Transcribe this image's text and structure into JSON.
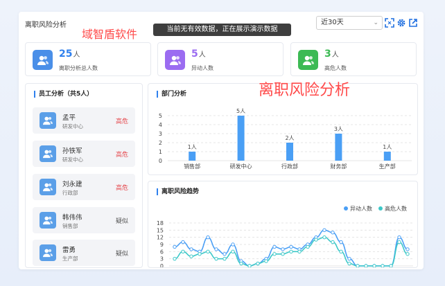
{
  "header": {
    "title": "离职风险分析",
    "watermark": "域智盾软件",
    "banner": "当前无有效数据，正在展示演示数据",
    "period_select": "近30天"
  },
  "stats": [
    {
      "value": "25",
      "unit": "人",
      "label": "离职分析总人数",
      "color": "#2f80ed"
    },
    {
      "value": "5",
      "unit": "人",
      "label": "异动人数",
      "color": "#9b6cf1"
    },
    {
      "value": "3",
      "unit": "人",
      "label": "高危人数",
      "color": "#3cba54"
    }
  ],
  "employees": {
    "title": "员工分析（共5人）",
    "items": [
      {
        "name": "孟平",
        "dept": "研发中心",
        "status": "高危",
        "status_color": "#e5484d"
      },
      {
        "name": "孙铁军",
        "dept": "研发中心",
        "status": "高危",
        "status_color": "#e5484d"
      },
      {
        "name": "刘永建",
        "dept": "行政部",
        "status": "高危",
        "status_color": "#e5484d"
      },
      {
        "name": "韩伟伟",
        "dept": "销售部",
        "status": "疑似",
        "status_color": "#555555"
      },
      {
        "name": "雷勇",
        "dept": "生产部",
        "status": "疑似",
        "status_color": "#555555"
      }
    ]
  },
  "dept_section": {
    "title": "部门分析",
    "overlay_text": "离职风险分析"
  },
  "trend_section": {
    "title": "离职风险趋势"
  },
  "chart_data": [
    {
      "type": "bar",
      "categories": [
        "销售部",
        "研发中心",
        "行政部",
        "财务部",
        "生产部"
      ],
      "values": [
        1,
        5,
        2,
        3,
        1
      ],
      "data_labels": [
        "1人",
        "5人",
        "2人",
        "3人",
        "1人"
      ],
      "ylim": [
        0,
        5
      ],
      "yticks": [
        0,
        1,
        2,
        3,
        4,
        5
      ],
      "color": "#4a9ff5",
      "grid": true
    },
    {
      "type": "line",
      "series": [
        {
          "name": "异动人数",
          "color": "#4a9ff5",
          "values": [
            8,
            10,
            7,
            6,
            12,
            7,
            5,
            9,
            2,
            0,
            1,
            3,
            8,
            7,
            8,
            7,
            9,
            12,
            15,
            14,
            10,
            3,
            0,
            0,
            0,
            0,
            0,
            12,
            7
          ]
        },
        {
          "name": "高危人数",
          "color": "#3cc8c8",
          "values": [
            3,
            6,
            4,
            5,
            6,
            3,
            3,
            6,
            1,
            0,
            1,
            2,
            5,
            5,
            6,
            6,
            8,
            11,
            12,
            10,
            6,
            1,
            0,
            0,
            0,
            0,
            0,
            10,
            5
          ]
        }
      ],
      "ylim": [
        0,
        18
      ],
      "yticks": [
        0,
        3,
        6,
        9,
        12,
        15,
        18
      ],
      "legend": "top-right",
      "grid": true
    }
  ]
}
